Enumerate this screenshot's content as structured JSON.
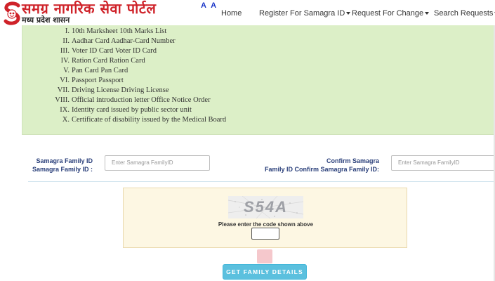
{
  "header": {
    "logo_letter": "S",
    "logo_title": "समग्र नागरिक सेवा पोर्टल",
    "logo_subtitle": "मध्य प्रदेश शासन",
    "font_size_control": "A A"
  },
  "nav": {
    "items": [
      {
        "label": "Home",
        "dropdown": false
      },
      {
        "label": "Register For Samagra ID",
        "dropdown": true
      },
      {
        "label": "Request For Change",
        "dropdown": true
      },
      {
        "label": "Search Requests",
        "dropdown": true
      }
    ]
  },
  "documents": {
    "items": [
      {
        "num": "I.",
        "text": "10th Marksheet 10th Marks List"
      },
      {
        "num": "II.",
        "text": "Aadhar Card Aadhar-Card Number"
      },
      {
        "num": "III.",
        "text": "Voter ID Card Voter ID Card"
      },
      {
        "num": "IV.",
        "text": "Ration Card Ration Card"
      },
      {
        "num": "V.",
        "text": "Pan Card Pan Card"
      },
      {
        "num": "VI.",
        "text": "Passport Passport"
      },
      {
        "num": "VII.",
        "text": "Driving License Driving License"
      },
      {
        "num": "VIII.",
        "text": "Official introduction letter Office Notice Order"
      },
      {
        "num": "IX.",
        "text": "Identity card issued by public sector unit"
      },
      {
        "num": "X.",
        "text": "Certificate of disability issued by the Medical Board"
      }
    ]
  },
  "form": {
    "family_id_label_line1": "Samagra Family ID",
    "family_id_label_line2": "Samagra Family ID :",
    "family_id_placeholder": "Enter Samagra FamilyID",
    "confirm_label_line1": "Confirm Samagra",
    "confirm_label_line2": "Family ID Confirm Samagra Family ID:",
    "confirm_placeholder": "Enter Samagra FamilyID"
  },
  "captcha": {
    "code": "S54A",
    "hint": "Please enter the code shown above"
  },
  "submit": {
    "label": "GET FAMILY DETAILS"
  },
  "colors": {
    "brand_red": "#cf2229",
    "panel_green": "#dcefc7",
    "label_blue": "#2a3f7a",
    "button_blue": "#5bc0de",
    "captcha_bg": "#fdf7e3"
  }
}
